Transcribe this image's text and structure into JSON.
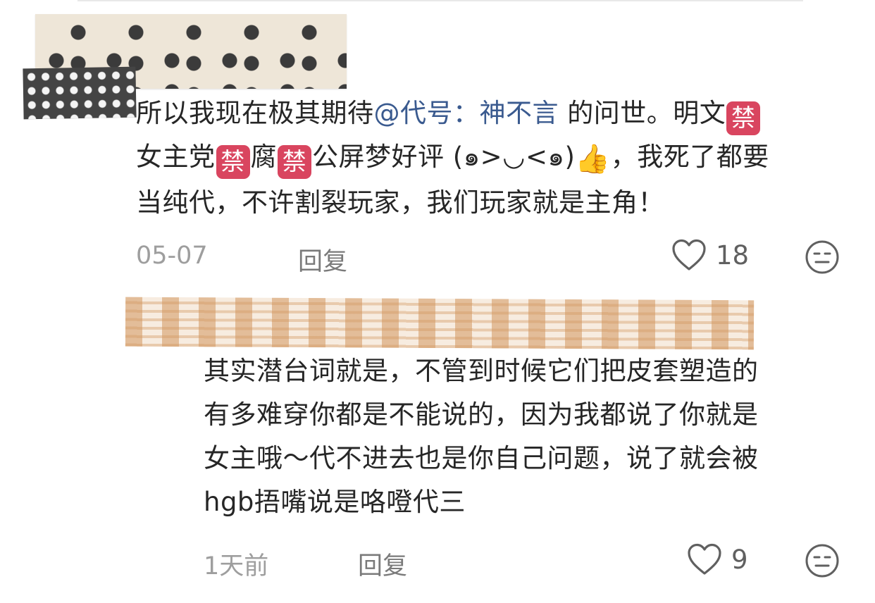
{
  "comment1": {
    "line1_a": "所以我现在极其期待",
    "mention": "@代号：神不言",
    "line1_b": "的问世。明文",
    "ban_icon": "禁",
    "line2_a": "女主党",
    "line2_b": "腐",
    "line2_c": "公屏梦好评 (๑>◡<๑)",
    "thumb_icon": "👍",
    "line2_d": "，我死了都要",
    "line3": "当纯代，不许割裂玩家，我们玩家就是主角！",
    "date": "05-07",
    "reply_label": "回复",
    "like_count": "18",
    "icons": {
      "like": "heart-outline-icon",
      "react": "neutral-face-icon"
    }
  },
  "comment2": {
    "line1": "其实潜台词就是，不管到时候它们把皮套塑造的",
    "line2": "有多难穿你都是不能说的，因为我都说了你就是",
    "line3": "女主哦～代不进去也是你自己问题，说了就会被",
    "line4": "hgb捂嘴说是咯噔代三",
    "date": "1天前",
    "reply_label": "回复",
    "like_count": "9",
    "icons": {
      "like": "heart-outline-icon",
      "react": "neutral-face-icon"
    }
  },
  "colors": {
    "text": "#262626",
    "mention": "#3a5a8f",
    "meta": "#9e9e9e",
    "ban_badge": "#d9455f"
  }
}
